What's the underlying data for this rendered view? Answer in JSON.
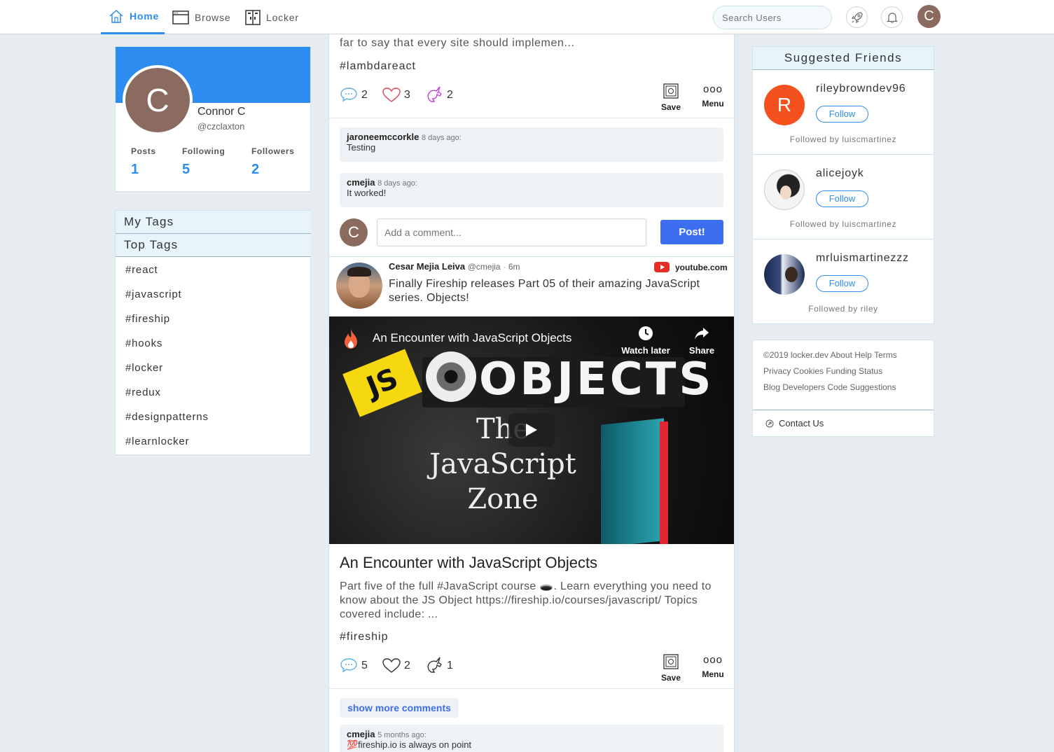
{
  "nav": {
    "home": "Home",
    "browse": "Browse",
    "locker": "Locker",
    "search_placeholder": "Search Users",
    "avatar_initial": "C"
  },
  "profile": {
    "initial": "C",
    "name": "Connor C",
    "handle": "@czclaxton",
    "stats": [
      {
        "label": "Posts",
        "value": "1"
      },
      {
        "label": "Following",
        "value": "5"
      },
      {
        "label": "Followers",
        "value": "2"
      }
    ],
    "banner_color": "#2d8cf0"
  },
  "tags": {
    "my_tags": "My Tags",
    "top_tags": "Top Tags",
    "items": [
      "#react",
      "#javascript",
      "#fireship",
      "#hooks",
      "#locker",
      "#redux",
      "#designpatterns",
      "#learnlocker"
    ]
  },
  "post1": {
    "excerpt": "far to say that every site should implemen...",
    "tag": "#lambdareact",
    "comments": "2",
    "likes": "3",
    "unicorns": "2",
    "save": "Save",
    "menu": "Menu",
    "comment_list": [
      {
        "user": "jaroneemccorkle",
        "time": "8 days ago:",
        "text": "Testing"
      },
      {
        "user": "cmejia",
        "time": "8 days ago:",
        "text": "It worked!"
      }
    ],
    "comment_initial": "C",
    "comment_placeholder": "Add a comment...",
    "post_button": "Post!"
  },
  "post2": {
    "author": "Cesar Mejia Leiva",
    "handle": "@cmejia",
    "dot": "·",
    "time": "6m",
    "source": "youtube.com",
    "text": "Finally Fireship releases Part 05 of their amazing JavaScript series. Objects!",
    "video": {
      "title": "An Encounter with JavaScript Objects",
      "watch_later": "Watch later",
      "share": "Share",
      "js": "JS",
      "big_word": "OBJECTS",
      "zone": [
        "The",
        "JavaScript",
        "Zone"
      ]
    },
    "link_title": "An Encounter with JavaScript Objects",
    "link_desc": "Part five of the full #JavaScript course 🕳️. Learn everything you need to know about the JS Object https://fireship.io/courses/javascript/ Topics covered include: ...",
    "tag": "#fireship",
    "comments": "5",
    "likes": "2",
    "unicorns": "1",
    "save": "Save",
    "menu": "Menu",
    "show_more": "show more comments",
    "comment": {
      "user": "cmejia",
      "time": "5 months ago:",
      "text": "💯fireship.io is always on point"
    }
  },
  "suggested": {
    "title": "Suggested Friends",
    "follow_label": "Follow",
    "items": [
      {
        "name": "rileybrowndev96",
        "initial": "R",
        "followed_by": "Followed by luiscmartinez"
      },
      {
        "name": "alicejoyk",
        "followed_by": "Followed by luiscmartinez"
      },
      {
        "name": "mrluismartinezzz",
        "followed_by": "Followed by riley"
      }
    ]
  },
  "footer": {
    "lines": [
      "©2019 locker.dev About Help Terms",
      "Privacy Cookies Funding Status",
      "Blog Developers Code Suggestions"
    ],
    "contact": "Contact Us"
  },
  "colors": {
    "accent": "#2d8cf0",
    "post_button": "#3d6ef0",
    "avatar": "#8b6b60",
    "riley_avatar": "#f4511e",
    "background": "#e6ecf0"
  }
}
